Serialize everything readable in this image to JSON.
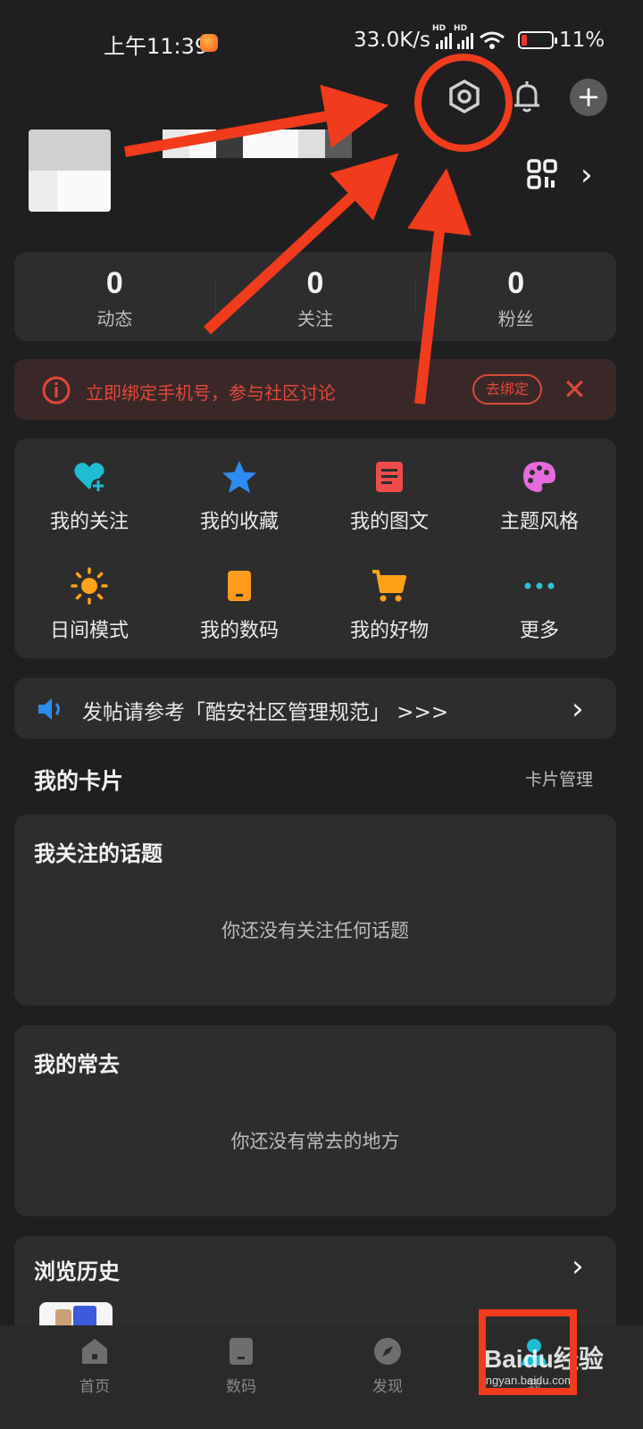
{
  "status_bar": {
    "time": "上午11:39",
    "network_speed": "33.0K/s",
    "battery": "11%"
  },
  "header": {
    "icons": [
      "gear-icon",
      "bell-icon",
      "plus-icon"
    ]
  },
  "profile": {
    "qr_icon": "qr-code-icon"
  },
  "stats": [
    {
      "value": "0",
      "label": "动态"
    },
    {
      "value": "0",
      "label": "关注"
    },
    {
      "value": "0",
      "label": "粉丝"
    }
  ],
  "bind_banner": {
    "text": "立即绑定手机号，参与社区讨论",
    "button": "去绑定",
    "close": "✕"
  },
  "grid_menu": [
    {
      "label": "我的关注",
      "icon": "heart-plus-icon",
      "color": "#1fbcd2"
    },
    {
      "label": "我的收藏",
      "icon": "star-icon",
      "color": "#2d8cf0"
    },
    {
      "label": "我的图文",
      "icon": "document-icon",
      "color": "#ef4b4b"
    },
    {
      "label": "主题风格",
      "icon": "palette-icon",
      "color": "#e66bdc"
    },
    {
      "label": "日间模式",
      "icon": "sun-icon",
      "color": "#ffa21a"
    },
    {
      "label": "我的数码",
      "icon": "phone-icon",
      "color": "#ff9a1a"
    },
    {
      "label": "我的好物",
      "icon": "cart-icon",
      "color": "#ffa21a"
    },
    {
      "label": "更多",
      "icon": "more-icon",
      "color": "#2ec2d8"
    }
  ],
  "notice": {
    "text": "发帖请参考「酷安社区管理规范」 >>>"
  },
  "my_cards": {
    "title": "我的卡片",
    "action": "卡片管理"
  },
  "followed_topics": {
    "title": "我关注的话题",
    "empty": "你还没有关注任何话题"
  },
  "frequent": {
    "title": "我的常去",
    "empty": "你还没有常去的地方"
  },
  "history": {
    "title": "浏览历史"
  },
  "bottom_nav": [
    {
      "label": "首页",
      "icon": "home-icon"
    },
    {
      "label": "数码",
      "icon": "device-icon"
    },
    {
      "label": "发现",
      "icon": "compass-icon"
    },
    {
      "label": "我",
      "icon": "user-icon"
    }
  ],
  "watermark": {
    "logo": "Baidu经验",
    "url": "jingyan.baidu.com"
  },
  "colors": {
    "background": "#1f1f1f",
    "card": "#2d2d2d",
    "annotation": "#f03b1c",
    "warning": "#e0473a"
  }
}
